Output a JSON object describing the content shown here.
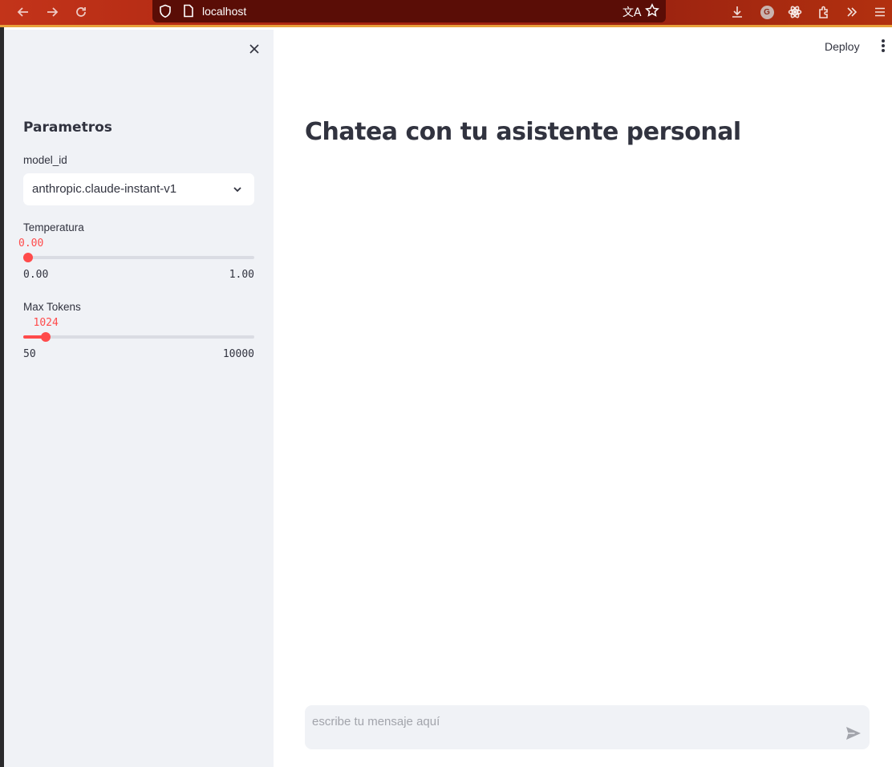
{
  "browser": {
    "url": "localhost",
    "profile_initial": "G"
  },
  "sidebar": {
    "title": "Parametros",
    "model_select": {
      "label": "model_id",
      "value": "anthropic.claude-instant-v1"
    },
    "temperature": {
      "label": "Temperatura",
      "value_text": "0.00",
      "min_text": "0.00",
      "max_text": "1.00",
      "value": 0.0,
      "min": 0.0,
      "max": 1.0
    },
    "max_tokens": {
      "label": "Max Tokens",
      "value_text": "1024",
      "min_text": "50",
      "max_text": "10000",
      "value": 1024,
      "min": 50,
      "max": 10000
    }
  },
  "header": {
    "deploy_label": "Deploy"
  },
  "main": {
    "title": "Chatea con tu asistente personal",
    "chat_input": {
      "placeholder": "escribe tu mensaje aquí",
      "value": ""
    }
  },
  "colors": {
    "accent": "#ff4b4b",
    "sidebar_bg": "#f0f2f6",
    "text": "#31333f"
  }
}
